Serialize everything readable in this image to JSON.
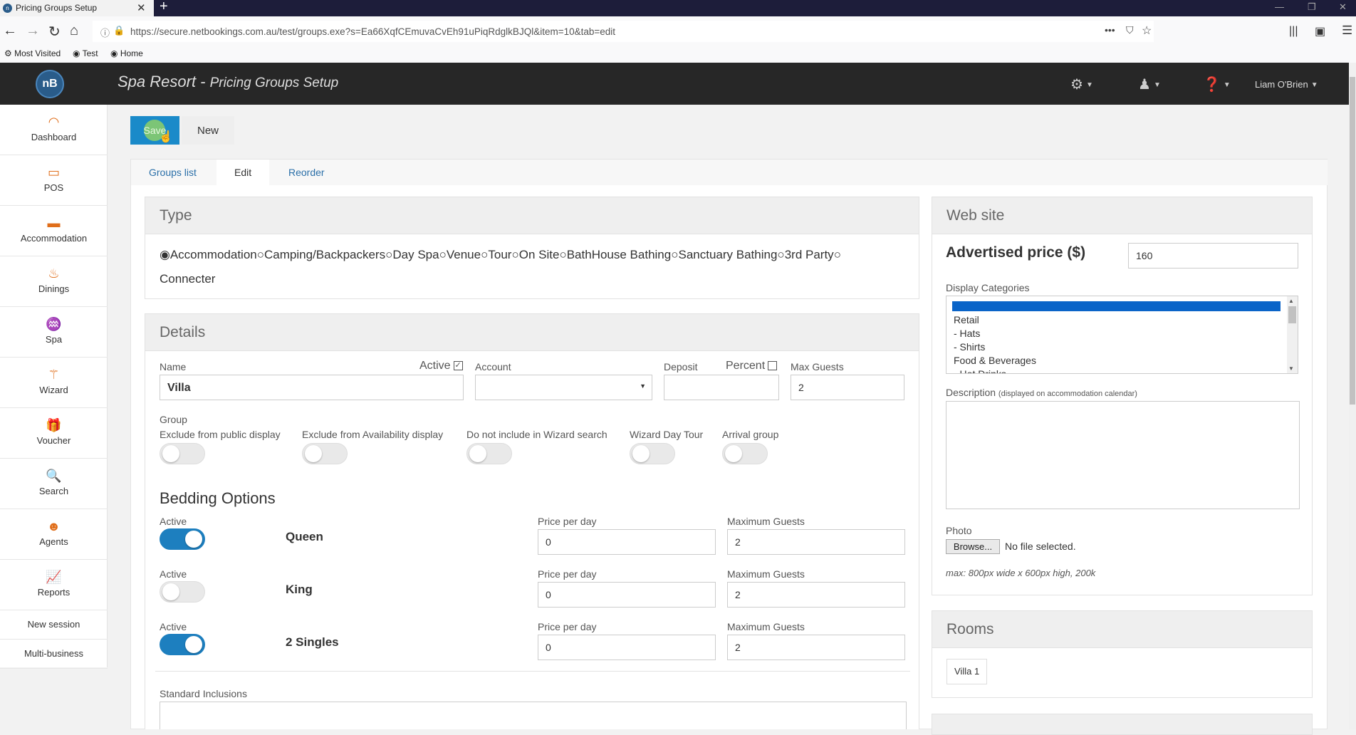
{
  "browser": {
    "tab_title": "Pricing Groups Setup",
    "url": "https://secure.netbookings.com.au/test/groups.exe?s=Ea66XqfCEmuvaCvEh91uPiqRdglkBJQl&item=10&tab=edit",
    "url_domain": "netbookings.com.au",
    "bookmarks": [
      "Most Visited",
      "Test",
      "Home"
    ]
  },
  "header": {
    "logo": "nB",
    "title": "Spa Resort",
    "subtitle": "Pricing Groups Setup",
    "user": "Liam O'Brien"
  },
  "sidebar": {
    "items": [
      "Dashboard",
      "POS",
      "Accommodation",
      "Dinings",
      "Spa",
      "Wizard",
      "Voucher",
      "Search",
      "Agents",
      "Reports"
    ],
    "links": [
      "New session",
      "Multi-business"
    ]
  },
  "toolbar": {
    "save": "Save",
    "new": "New"
  },
  "tabs": [
    "Groups list",
    "Edit",
    "Reorder"
  ],
  "type": {
    "heading": "Type",
    "options": [
      "Accommodation",
      "Camping/Backpackers",
      "Day Spa",
      "Venue",
      "Tour",
      "On Site",
      "BathHouse Bathing",
      "Sanctuary Bathing",
      "3rd Party",
      "Connecter"
    ],
    "selected": "Accommodation"
  },
  "details": {
    "heading": "Details",
    "name_label": "Name",
    "name_value": "Villa",
    "active_label": "Active",
    "account_label": "Account",
    "deposit_label": "Deposit",
    "percent_label": "Percent",
    "max_guests_label": "Max Guests",
    "max_guests_value": "2",
    "group_label": "Group",
    "flags": [
      "Exclude from public display",
      "Exclude from Availability display",
      "Do not include in Wizard search",
      "Wizard Day Tour",
      "Arrival group"
    ]
  },
  "bedding": {
    "heading": "Bedding Options",
    "active_label": "Active",
    "price_label": "Price per day",
    "guests_label": "Maximum Guests",
    "rows": [
      {
        "name": "Queen",
        "active": true,
        "price": "0",
        "guests": "2"
      },
      {
        "name": "King",
        "active": false,
        "price": "0",
        "guests": "2"
      },
      {
        "name": "2 Singles",
        "active": true,
        "price": "0",
        "guests": "2"
      }
    ]
  },
  "inclusions_label": "Standard Inclusions",
  "website": {
    "heading": "Web site",
    "advertised_label": "Advertised price ($)",
    "advertised_value": "160",
    "display_categories_label": "Display Categories",
    "categories": [
      "Retail",
      "- Hats",
      "- Shirts",
      "Food & Beverages",
      "- Hot Drinks"
    ],
    "description_label": "Description",
    "description_hint": "(displayed on accommodation calendar)",
    "photo_label": "Photo",
    "browse_label": "Browse...",
    "no_file": "No file selected.",
    "photo_hint": "max: 800px wide x 600px high, 200k"
  },
  "rooms": {
    "heading": "Rooms",
    "items": [
      "Villa 1"
    ]
  },
  "colors": {
    "accent": "#1a8ac9",
    "header": "#272727",
    "icon": "#e06e1a"
  }
}
